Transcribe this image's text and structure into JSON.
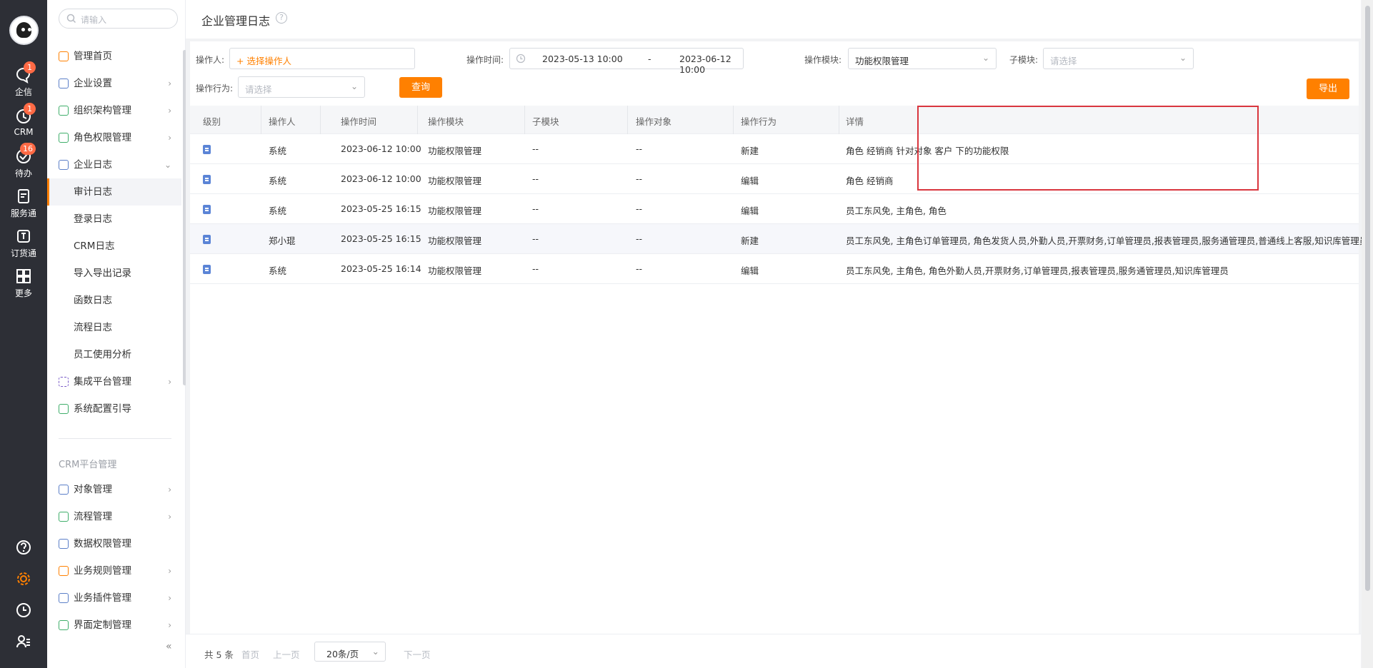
{
  "rail": {
    "items": [
      {
        "label": "企信",
        "icon": "chat-bubble-icon",
        "badge": "1"
      },
      {
        "label": "CRM",
        "icon": "clock-icon",
        "badge": "1"
      },
      {
        "label": "待办",
        "icon": "check-circle-icon",
        "badge": "16"
      },
      {
        "label": "服务通",
        "icon": "clipboard-icon",
        "badge": ""
      },
      {
        "label": "订货通",
        "icon": "order-icon",
        "badge": ""
      },
      {
        "label": "更多",
        "icon": "grid-icon",
        "badge": ""
      }
    ],
    "bottom": [
      "help-icon",
      "gear-icon",
      "history-icon",
      "user-list-icon"
    ],
    "accent": "#ff8000"
  },
  "sidebar": {
    "search_placeholder": "请输入",
    "items": [
      {
        "label": "管理首页",
        "arrow": ""
      },
      {
        "label": "企业设置",
        "arrow": "›"
      },
      {
        "label": "组织架构管理",
        "arrow": "›"
      },
      {
        "label": "角色权限管理",
        "arrow": "›"
      },
      {
        "label": "企业日志",
        "arrow": "⌄"
      }
    ],
    "subitems": [
      "审计日志",
      "登录日志",
      "CRM日志",
      "导入导出记录",
      "函数日志",
      "流程日志",
      "员工使用分析"
    ],
    "items2": [
      {
        "label": "集成平台管理",
        "arrow": "›"
      },
      {
        "label": "系统配置引导",
        "arrow": ""
      }
    ],
    "section_title": "CRM平台管理",
    "crm_items": [
      {
        "label": "对象管理",
        "arrow": "›"
      },
      {
        "label": "流程管理",
        "arrow": "›"
      },
      {
        "label": "数据权限管理",
        "arrow": ""
      },
      {
        "label": "业务规则管理",
        "arrow": "›"
      },
      {
        "label": "业务插件管理",
        "arrow": "›"
      },
      {
        "label": "界面定制管理",
        "arrow": "›"
      }
    ],
    "collapse": "«"
  },
  "page": {
    "title": "企业管理日志",
    "help": "?"
  },
  "filters": {
    "operator_label": "操作人:",
    "operator_value": "+ 选择操作人",
    "time_label": "操作时间:",
    "time_start": "2023-05-13 10:00",
    "time_sep": "-",
    "time_end": "2023-06-12 10:00",
    "module_label": "操作模块:",
    "module_value": "功能权限管理",
    "submodule_label": "子模块:",
    "submodule_placeholder": "请选择",
    "action_label": "操作行为:",
    "action_placeholder": "请选择",
    "query_button": "查询",
    "export_button": "导出"
  },
  "table": {
    "headers": [
      "级别",
      "操作人",
      "操作时间",
      "操作模块",
      "子模块",
      "操作对象",
      "操作行为",
      "详情"
    ],
    "rows": [
      {
        "operator": "系统",
        "time": "2023-06-12 10:00",
        "module": "功能权限管理",
        "submodule": "--",
        "object": "--",
        "action": "新建",
        "detail": "角色 经销商 针对对象 客户 下的功能权限"
      },
      {
        "operator": "系统",
        "time": "2023-06-12 10:00",
        "module": "功能权限管理",
        "submodule": "--",
        "object": "--",
        "action": "编辑",
        "detail": "角色 经销商"
      },
      {
        "operator": "系统",
        "time": "2023-05-25 16:15",
        "module": "功能权限管理",
        "submodule": "--",
        "object": "--",
        "action": "编辑",
        "detail": "员工东风免, 主角色, 角色"
      },
      {
        "operator": "郑小琨",
        "time": "2023-05-25 16:15",
        "module": "功能权限管理",
        "submodule": "--",
        "object": "--",
        "action": "新建",
        "detail": "员工东风免, 主角色订单管理员, 角色发货人员,外勤人员,开票财务,订单管理员,报表管理员,服务通管理员,普通线上客服,知识库管理员"
      },
      {
        "operator": "系统",
        "time": "2023-05-25 16:14",
        "module": "功能权限管理",
        "submodule": "--",
        "object": "--",
        "action": "编辑",
        "detail": "员工东风免, 主角色, 角色外勤人员,开票财务,订单管理员,报表管理员,服务通管理员,知识库管理员"
      }
    ]
  },
  "pager": {
    "total": "共 5 条",
    "first": "首页",
    "prev": "上一页",
    "page_size": "20条/页",
    "next": "下一页"
  }
}
